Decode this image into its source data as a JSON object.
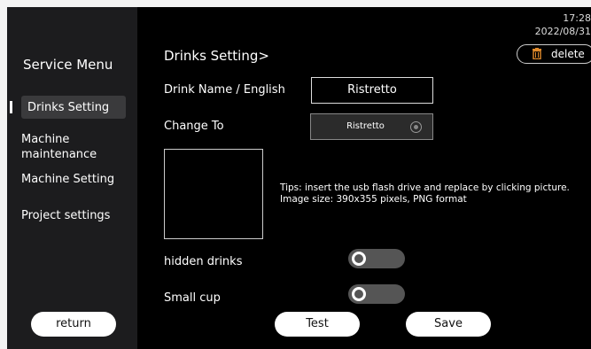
{
  "status": {
    "time": "17:28",
    "date": "2022/08/31"
  },
  "sidebar": {
    "title": "Service Menu",
    "items": [
      {
        "label": "Drinks Setting",
        "active": true
      },
      {
        "label": "Machine maintenance",
        "active": false
      },
      {
        "label": "Machine Setting",
        "active": false
      },
      {
        "label": "Project settings",
        "active": false
      }
    ],
    "return_label": "return"
  },
  "main": {
    "title": "Drinks Setting>",
    "delete_label": "delete",
    "drink_name_label": "Drink Name / English",
    "drink_name_value": "Ristretto",
    "change_to_label": "Change To",
    "change_to_value": "Ristretto",
    "tips": "Tips: insert the usb flash drive and replace by clicking picture. Image size: 390x355 pixels, PNG format",
    "toggles": [
      {
        "label": "hidden drinks",
        "on": false
      },
      {
        "label": "Small cup",
        "on": false
      }
    ],
    "test_label": "Test",
    "save_label": "Save"
  },
  "colors": {
    "background": "#000000",
    "sidebar": "#1c1c1e",
    "toggle_off": "#555555"
  }
}
